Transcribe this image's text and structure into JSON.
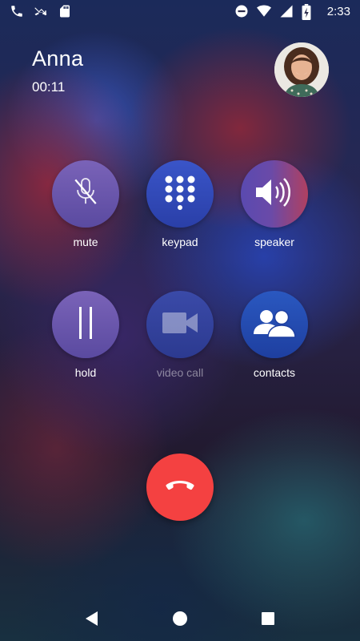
{
  "status_bar": {
    "time": "2:33",
    "left_icons": [
      "phone-icon",
      "missed-call-icon",
      "sd-card-icon"
    ],
    "right_icons": [
      "do-not-disturb-icon",
      "wifi-icon",
      "signal-icon",
      "battery-charging-icon"
    ]
  },
  "call": {
    "caller_name": "Anna",
    "duration": "00:11"
  },
  "controls": [
    {
      "id": "mute",
      "label": "mute",
      "icon": "mic-off-icon",
      "enabled": true
    },
    {
      "id": "keypad",
      "label": "keypad",
      "icon": "dialpad-icon",
      "enabled": true
    },
    {
      "id": "speaker",
      "label": "speaker",
      "icon": "speaker-icon",
      "enabled": true
    },
    {
      "id": "hold",
      "label": "hold",
      "icon": "pause-icon",
      "enabled": true
    },
    {
      "id": "video_call",
      "label": "video call",
      "icon": "videocam-icon",
      "enabled": false
    },
    {
      "id": "contacts",
      "label": "contacts",
      "icon": "contacts-icon",
      "enabled": true
    }
  ],
  "end_call": {
    "icon": "end-call-icon",
    "color": "#f44141"
  },
  "nav_bar": {
    "icons": [
      "back-icon",
      "home-icon",
      "recents-icon"
    ]
  },
  "colors": {
    "end_call": "#f44141",
    "accent_blue": "#2a3fa8",
    "accent_purple": "#6a55b0"
  }
}
